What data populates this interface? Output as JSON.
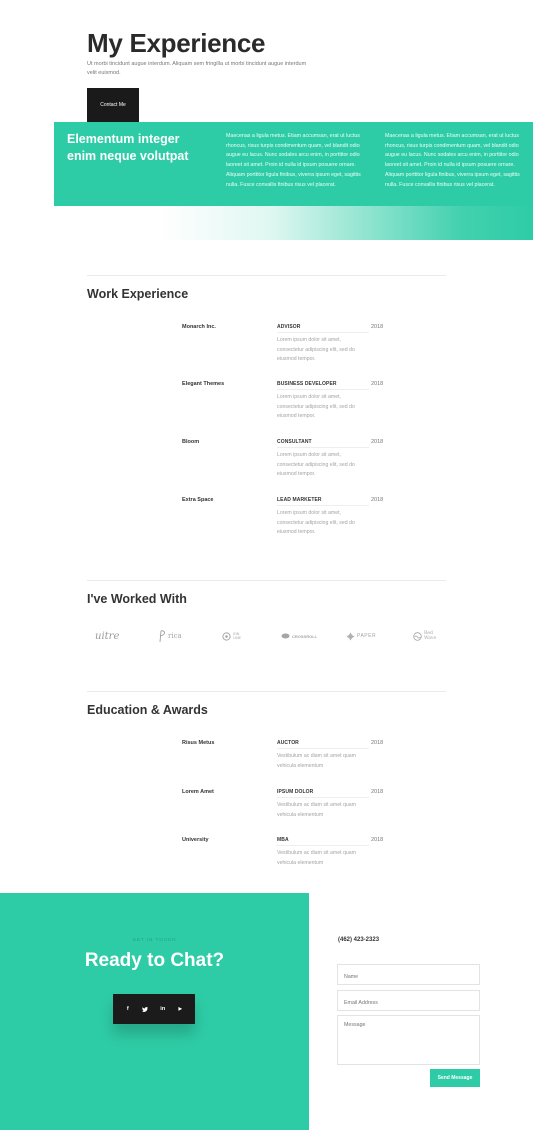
{
  "hero": {
    "title": "My Experience",
    "subtitle": "Ut morbi tincidunt augue interdum. Aliquam sem fringilla ut morbi tincidunt augue interdum velit euismod.",
    "button_label": "Contact Me"
  },
  "band": {
    "title": "Elementum integer enim neque volutpat",
    "text_1": "Maecenas a ligula metus. Etiam accumsan, erat ut luctus rhoncus, risus turpis condimentum quam, vel blandit odio augue eu lacus. Nunc sodales arcu enim, in porttitor odio laoreet sit amet. Proin id nulla id ipsum posuere ornare. Aliquam porttitor ligula finibus, viverra ipsum eget, sagittis nulla. Fusce convallis finibus risus vel placerat.",
    "text_2": "Maecenas a ligula metus. Etiam accumsan, erat ut luctus rhoncus, risus turpis condimentum quam, vel blandit odio augue eu lacus. Nunc sodales arcu enim, in porttitor odio laoreet sit amet. Proin id nulla id ipsum posuere ornare. Aliquam porttitor ligula finibus, viverra ipsum eget, sagittis nulla. Fusce convallis finibus risus vel placerat."
  },
  "work": {
    "title": "Work Experience",
    "rows": [
      {
        "company": "Monarch Inc.",
        "role": "ADVISOR",
        "year": "2018",
        "desc": "Lorem ipsum dolor sit amet, consectetur adipiscing elit, sed do eiusmod tempor."
      },
      {
        "company": "Elegant Themes",
        "role": "BUSINESS DEVELOPER",
        "year": "2018",
        "desc": "Lorem ipsum dolor sit amet, consectetur adipiscing elit, sed do eiusmod tempor."
      },
      {
        "company": "Bloom",
        "role": "CONSULTANT",
        "year": "2018",
        "desc": "Lorem ipsum dolor sit amet, consectetur adipiscing elit, sed do eiusmod tempor."
      },
      {
        "company": "Extra Space",
        "role": "LEAD MARKETER",
        "year": "2018",
        "desc": "Lorem ipsum dolor sit amet, consectetur adipiscing elit, sed do eiusmod tempor."
      }
    ]
  },
  "clients": {
    "title": "I've Worked With",
    "logos": [
      {
        "text": "uitre",
        "icon": "script-wordmark"
      },
      {
        "text": "rica",
        "icon": "script-p-logo"
      },
      {
        "text": "ION LINE",
        "icon": "circle-emblem"
      },
      {
        "text": "CROSSROLL",
        "icon": "oval-badge"
      },
      {
        "text": "PAPER",
        "icon": "diamond-flower"
      },
      {
        "text": "Red Wave",
        "icon": "wave-circle"
      }
    ]
  },
  "education": {
    "title": "Education & Awards",
    "rows": [
      {
        "school": "Risus Metus",
        "award": "AUCTOR",
        "year": "2018",
        "desc": "Vestibulum ac diam sit amet quam vehicula elementum"
      },
      {
        "school": "Lorem Amet",
        "award": "IPSUM DOLOR",
        "year": "2018",
        "desc": "Vestibulum ac diam sit amet quam vehicula elementum"
      },
      {
        "school": "University",
        "award": "MBA",
        "year": "2018",
        "desc": "Vestibulum ac diam sit amet quam vehicula elementum"
      }
    ]
  },
  "footer": {
    "eyebrow": "GET IN TOUCH",
    "title": "Ready to Chat?",
    "socials": [
      "f",
      "t",
      "in",
      "▶"
    ],
    "phone": "(462) 423-2323",
    "name_placeholder": "Name",
    "email_placeholder": "Email Address",
    "message_placeholder": "Message",
    "send_label": "Send Message"
  },
  "colors": {
    "accent": "#2ecca6",
    "dark": "#1a1a1a"
  }
}
